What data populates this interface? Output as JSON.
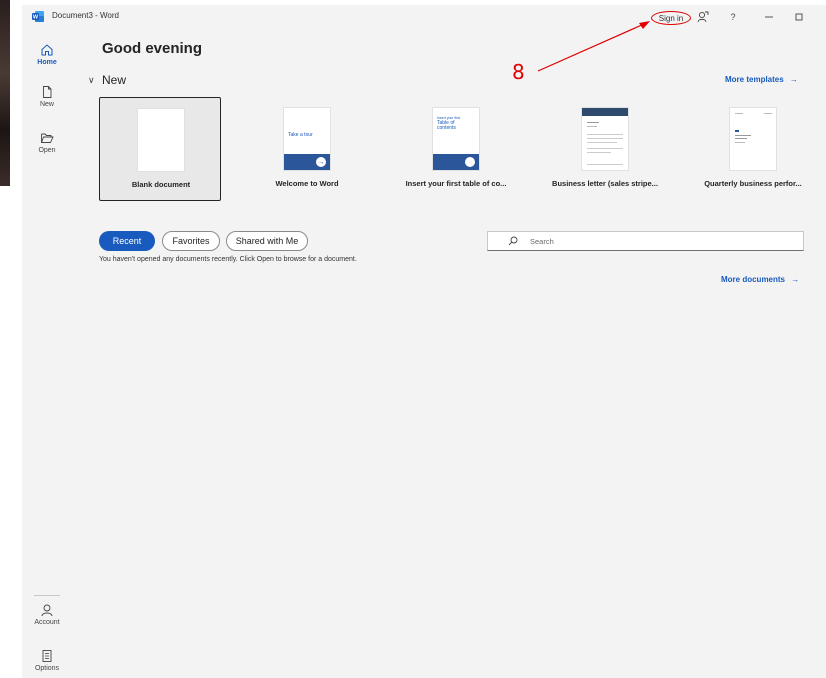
{
  "titlebar": {
    "doc_title": "Document3 - Word",
    "signin_label": "Sign in"
  },
  "annotation": {
    "number": "8"
  },
  "nav": {
    "items": [
      {
        "label": "Home",
        "icon": "home-icon"
      },
      {
        "label": "New",
        "icon": "new-document-icon"
      },
      {
        "label": "Open",
        "icon": "folder-open-icon"
      },
      {
        "label": "Account",
        "icon": "person-icon"
      },
      {
        "label": "Options",
        "icon": "options-icon"
      }
    ]
  },
  "main": {
    "greeting": "Good evening",
    "new_section": "New",
    "more_templates": "More templates",
    "templates": [
      {
        "label": "Blank document"
      },
      {
        "label": "Welcome to Word",
        "thumb_text": "Take a tour"
      },
      {
        "label": "Insert your first table of co...",
        "thumb_text_1": "Insert your first",
        "thumb_text_2": "Table of contents"
      },
      {
        "label": "Business letter (sales stripe..."
      },
      {
        "label": "Quarterly business perfor..."
      }
    ],
    "recent_tabs": [
      "Recent",
      "Favorites",
      "Shared with Me"
    ],
    "search_placeholder": "Search",
    "empty_message": "You haven't opened any documents recently. Click Open to browse for a document.",
    "more_documents": "More documents"
  },
  "colors": {
    "accent": "#185abd",
    "annotation": "#e00000"
  }
}
